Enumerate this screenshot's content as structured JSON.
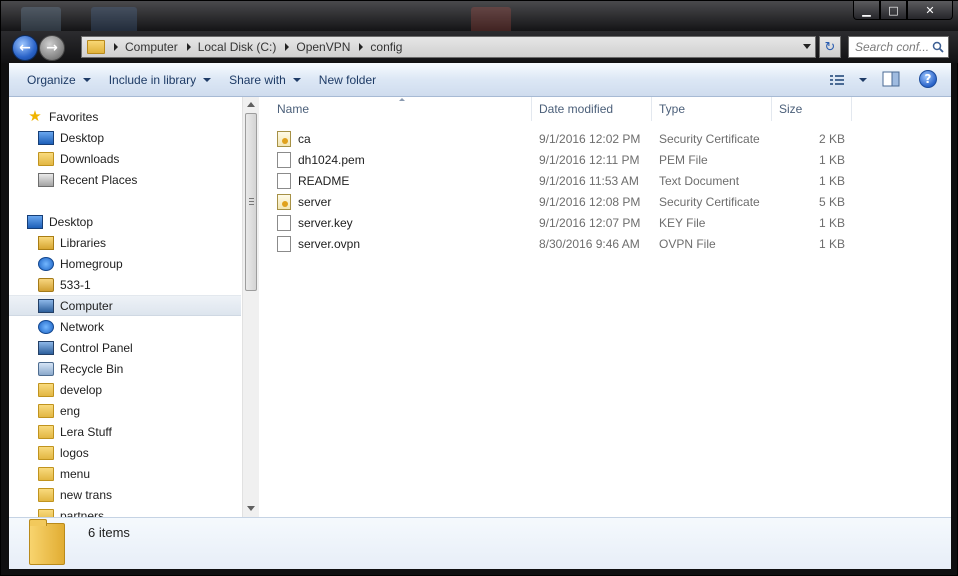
{
  "window": {
    "minimize_glyph": "▁",
    "maximize_glyph": "□",
    "close_glyph": "✕"
  },
  "address": {
    "crumbs": [
      "Computer",
      "Local Disk (C:)",
      "OpenVPN",
      "config"
    ],
    "search_placeholder": "Search conf...",
    "back_glyph": "←",
    "forward_glyph": "→",
    "refresh_glyph": "↻"
  },
  "toolbar": {
    "organize": "Organize",
    "include_in_library": "Include in library",
    "share_with": "Share with",
    "new_folder": "New folder",
    "help_glyph": "?"
  },
  "nav": {
    "favorites": "Favorites",
    "fav_desktop": "Desktop",
    "downloads": "Downloads",
    "recent_places": "Recent Places",
    "desktop": "Desktop",
    "libraries": "Libraries",
    "homegroup": "Homegroup",
    "user_533": "533-1",
    "computer": "Computer",
    "network": "Network",
    "control_panel": "Control Panel",
    "recycle_bin": "Recycle Bin",
    "develop": "develop",
    "eng": "eng",
    "lera_stuff": "Lera Stuff",
    "logos": "logos",
    "menu": "menu",
    "new_trans": "new trans",
    "partners": "partners"
  },
  "columns": {
    "name": "Name",
    "date_modified": "Date modified",
    "type": "Type",
    "size": "Size"
  },
  "files": [
    {
      "name": "ca",
      "date": "9/1/2016 12:02 PM",
      "type": "Security Certificate",
      "size": "2 KB",
      "icon": "certificate-icon"
    },
    {
      "name": "dh1024.pem",
      "date": "9/1/2016 12:11 PM",
      "type": "PEM File",
      "size": "1 KB",
      "icon": "file-icon"
    },
    {
      "name": "README",
      "date": "9/1/2016 11:53 AM",
      "type": "Text Document",
      "size": "1 KB",
      "icon": "file-icon"
    },
    {
      "name": "server",
      "date": "9/1/2016 12:08 PM",
      "type": "Security Certificate",
      "size": "5 KB",
      "icon": "certificate-icon"
    },
    {
      "name": "server.key",
      "date": "9/1/2016 12:07 PM",
      "type": "KEY File",
      "size": "1 KB",
      "icon": "file-icon"
    },
    {
      "name": "server.ovpn",
      "date": "8/30/2016 9:46 AM",
      "type": "OVPN File",
      "size": "1 KB",
      "icon": "file-icon"
    }
  ],
  "details": {
    "item_count": "6 items"
  },
  "colors": {
    "selection": "#dde5ee",
    "header_text": "#4c607a",
    "secondary_text": "#6d6d6d"
  }
}
